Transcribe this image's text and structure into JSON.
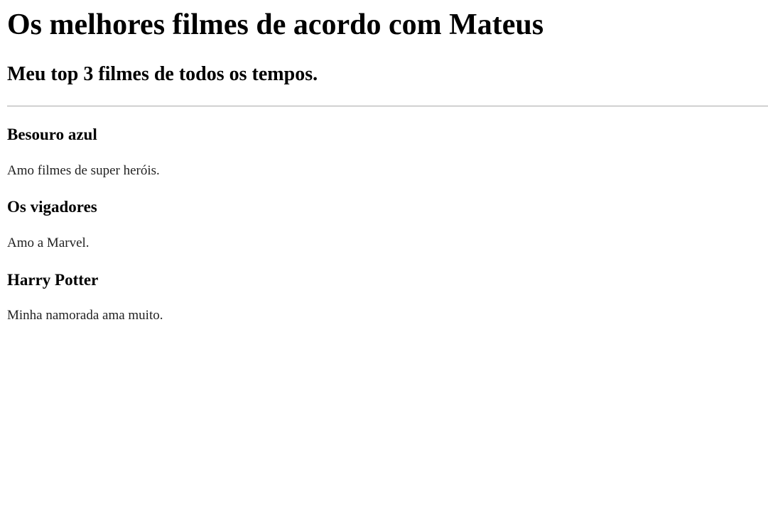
{
  "header": {
    "title": "Os melhores filmes de acordo com Mateus",
    "subtitle": "Meu top 3 filmes de todos os tempos."
  },
  "movies": [
    {
      "title": "Besouro azul",
      "description": "Amo filmes de super heróis."
    },
    {
      "title": "Os vigadores",
      "description": "Amo a Marvel."
    },
    {
      "title": "Harry Potter",
      "description": "Minha namorada ama muito."
    }
  ]
}
